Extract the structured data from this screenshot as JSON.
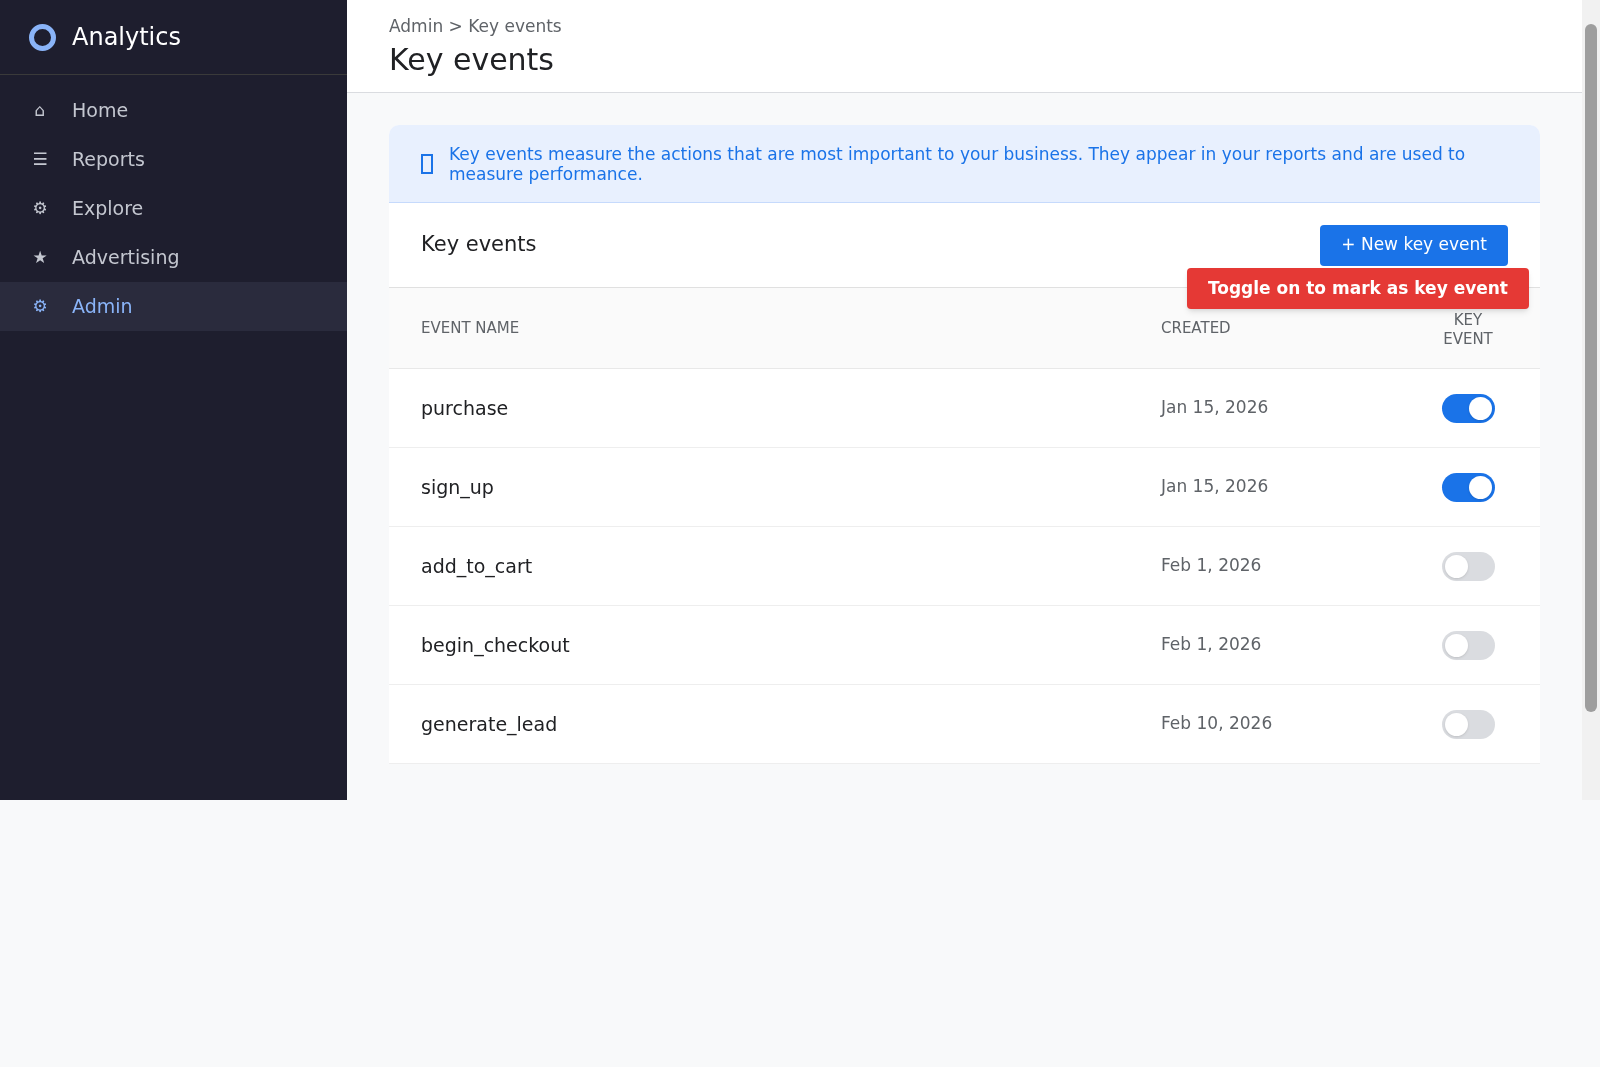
{
  "brand": {
    "name": "Analytics"
  },
  "sidebar": {
    "items": [
      {
        "label": "Home",
        "icon": "⌂",
        "selected": false
      },
      {
        "label": "Reports",
        "icon": "☰",
        "selected": false
      },
      {
        "label": "Explore",
        "icon": "⚙",
        "selected": false
      },
      {
        "label": "Advertising",
        "icon": "★",
        "selected": false
      },
      {
        "label": "Admin",
        "icon": "⚙",
        "selected": true
      }
    ]
  },
  "header": {
    "breadcrumb": "Admin > Key events",
    "title": "Key events"
  },
  "banner": {
    "text": "Key events measure the actions that are most important to your business. They appear in your reports and are used to measure performance."
  },
  "card": {
    "title": "Key events",
    "new_button": "+ New key event",
    "tooltip": "Toggle on to mark as key event"
  },
  "table": {
    "columns": [
      "EVENT NAME",
      "CREATED",
      "KEY EVENT"
    ],
    "rows": [
      {
        "name": "purchase",
        "created": "Jan 15, 2026",
        "on": true
      },
      {
        "name": "sign_up",
        "created": "Jan 15, 2026",
        "on": true
      },
      {
        "name": "add_to_cart",
        "created": "Feb 1, 2026",
        "on": false
      },
      {
        "name": "begin_checkout",
        "created": "Feb 1, 2026",
        "on": false
      },
      {
        "name": "generate_lead",
        "created": "Feb 10, 2026",
        "on": false
      }
    ]
  }
}
